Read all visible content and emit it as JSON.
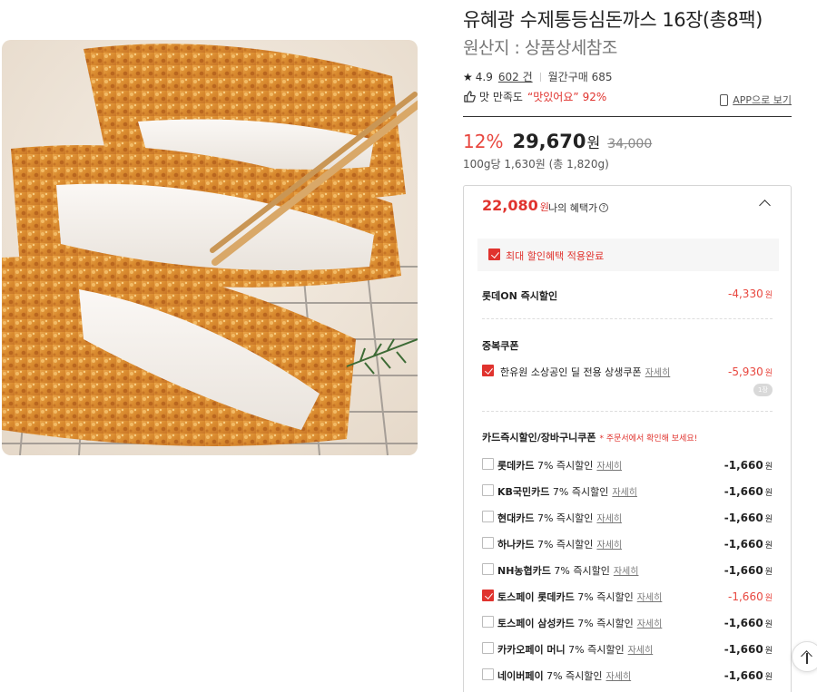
{
  "product": {
    "title": "유혜광 수제통등심돈까스 16장(총8팩)",
    "origin": "원산지 : 상품상세참조"
  },
  "rating": {
    "score": "4.9",
    "reviews": "602 건",
    "monthly": "월간구매 685"
  },
  "taste": {
    "label": "맛 만족도",
    "quote": "“맛있어요”",
    "percent": "92%"
  },
  "app_link": "APP으로 보기",
  "price": {
    "discount_rate": "12%",
    "sale_price": "29,670",
    "currency": "원",
    "original_price": "34,000",
    "unit_price": "100g당 1,630원 (총 1,820g)"
  },
  "benefit": {
    "price": "22,080",
    "currency": "원",
    "label": "나의 혜택가",
    "applied_label": "최대 할인혜택 적용완료",
    "instant": {
      "label": "롯데ON 즉시할인",
      "amount": "-4,330"
    },
    "coupon_section": "중복쿠폰",
    "coupon": {
      "label": "한유원 소상공인 딜 전용 상생쿠폰",
      "detail": "자세히",
      "amount": "-5,930",
      "count": "1장"
    },
    "card_section": "카드즉시할인/장바구니쿠폰",
    "card_note": "* 주문서에서 확인해 보세요!",
    "cards": [
      {
        "name": "롯데카드",
        "desc": "7% 즉시할인",
        "detail": "자세히",
        "amount": "-1,660",
        "checked": false
      },
      {
        "name": "KB국민카드",
        "desc": "7% 즉시할인",
        "detail": "자세히",
        "amount": "-1,660",
        "checked": false
      },
      {
        "name": "현대카드",
        "desc": "7% 즉시할인",
        "detail": "자세히",
        "amount": "-1,660",
        "checked": false
      },
      {
        "name": "하나카드",
        "desc": "7% 즉시할인",
        "detail": "자세히",
        "amount": "-1,660",
        "checked": false
      },
      {
        "name": "NH농협카드",
        "desc": "7% 즉시할인",
        "detail": "자세히",
        "amount": "-1,660",
        "checked": false
      },
      {
        "name": "토스페이 롯데카드",
        "desc": "7% 즉시할인",
        "detail": "자세히",
        "amount": "-1,660",
        "checked": true
      },
      {
        "name": "토스페이 삼성카드",
        "desc": "7% 즉시할인",
        "detail": "자세히",
        "amount": "-1,660",
        "checked": false
      },
      {
        "name": "카카오페이 머니",
        "desc": "7% 즉시할인",
        "detail": "자세히",
        "amount": "-1,660",
        "checked": false
      },
      {
        "name": "네이버페이",
        "desc": "7% 즉시할인",
        "detail": "자세히",
        "amount": "-1,660",
        "checked": false
      }
    ]
  },
  "colors": {
    "accent": "#e0332e",
    "discount": "#e8473f"
  }
}
